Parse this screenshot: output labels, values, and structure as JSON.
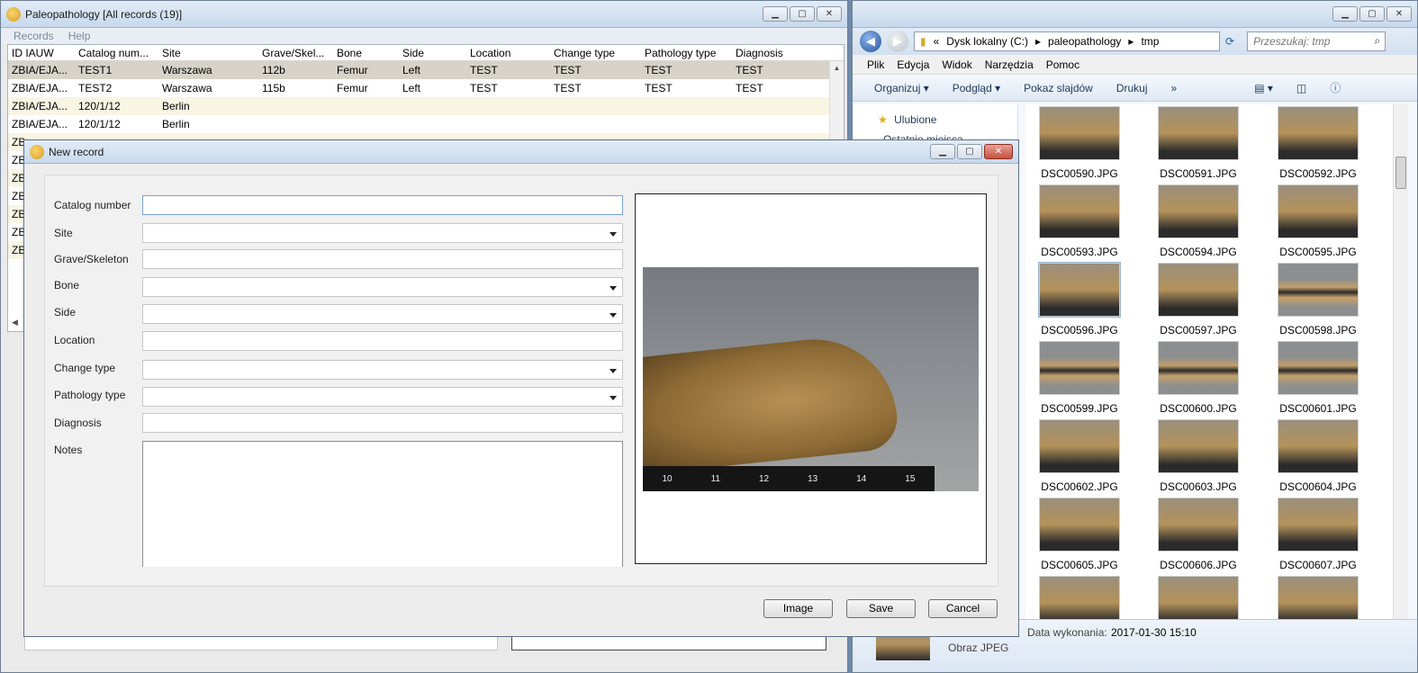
{
  "main": {
    "title": "Paleopathology [All records (19)]",
    "menu": [
      "Records",
      "Help"
    ],
    "columns": [
      "ID IAUW",
      "Catalog num...",
      "Site",
      "Grave/Skel...",
      "Bone",
      "Side",
      "Location",
      "Change type",
      "Pathology type",
      "Diagnosis"
    ],
    "rows": [
      [
        "ZBIA/EJA...",
        "TEST1",
        "Warszawa",
        "112b",
        "Femur",
        "Left",
        "TEST",
        "TEST",
        "TEST",
        "TEST"
      ],
      [
        "ZBIA/EJA...",
        "TEST2",
        "Warszawa",
        "115b",
        "Femur",
        "Left",
        "TEST",
        "TEST",
        "TEST",
        "TEST"
      ],
      [
        "ZBIA/EJA...",
        "120/1/12",
        "Berlin",
        "",
        "",
        "",
        "",
        "",
        "",
        ""
      ],
      [
        "ZBIA/EJA...",
        "120/1/12",
        "Berlin",
        "",
        "",
        "",
        "",
        "",
        "",
        ""
      ],
      [
        "ZB",
        "",
        "",
        "",
        "",
        "",
        "",
        "",
        "",
        ""
      ],
      [
        "ZB",
        "",
        "",
        "",
        "",
        "",
        "",
        "",
        "",
        ""
      ],
      [
        "ZB",
        "",
        "",
        "",
        "",
        "",
        "",
        "",
        "",
        ""
      ],
      [
        "ZB",
        "",
        "",
        "",
        "",
        "",
        "",
        "",
        "",
        ""
      ],
      [
        "ZB",
        "",
        "",
        "",
        "",
        "",
        "",
        "",
        "",
        ""
      ],
      [
        "ZB",
        "",
        "",
        "",
        "",
        "",
        "",
        "",
        "",
        ""
      ],
      [
        "ZB",
        "",
        "",
        "",
        "",
        "",
        "",
        "",
        "",
        ""
      ]
    ]
  },
  "dialog": {
    "title": "New record",
    "labels": {
      "catalog": "Catalog number",
      "site": "Site",
      "grave": "Grave/Skeleton",
      "bone": "Bone",
      "side": "Side",
      "location": "Location",
      "change": "Change type",
      "pathology": "Pathology type",
      "diagnosis": "Diagnosis",
      "notes": "Notes"
    },
    "ruler_ticks": [
      "10",
      "11",
      "12",
      "13",
      "14",
      "15"
    ],
    "buttons": {
      "image": "Image",
      "save": "Save",
      "cancel": "Cancel"
    }
  },
  "explorer": {
    "breadcrumb": [
      "«",
      "Dysk lokalny (C:)",
      "paleopathology",
      "tmp"
    ],
    "search_placeholder": "Przeszukaj: tmp",
    "menu": [
      "Plik",
      "Edycja",
      "Widok",
      "Narzędzia",
      "Pomoc"
    ],
    "toolbar": [
      "Organizuj ▾",
      "Podgląd ▾",
      "Pokaz slajdów",
      "Drukuj",
      "»"
    ],
    "nav_favorites": "Ulubione",
    "nav_recent": "Ostatnie miejsca",
    "files": [
      "DSC00590.JPG",
      "DSC00591.JPG",
      "DSC00592.JPG",
      "DSC00593.JPG",
      "DSC00594.JPG",
      "DSC00595.JPG",
      "DSC00596.JPG",
      "DSC00597.JPG",
      "DSC00598.JPG",
      "DSC00599.JPG",
      "DSC00600.JPG",
      "DSC00601.JPG",
      "DSC00602.JPG",
      "DSC00603.JPG",
      "DSC00604.JPG",
      "DSC00605.JPG",
      "DSC00606.JPG",
      "DSC00607.JPG",
      "",
      "",
      ""
    ],
    "details": {
      "date_label": "Data wykonania:",
      "date_value": "2017-01-30 15:10",
      "type": "Obraz JPEG"
    }
  }
}
